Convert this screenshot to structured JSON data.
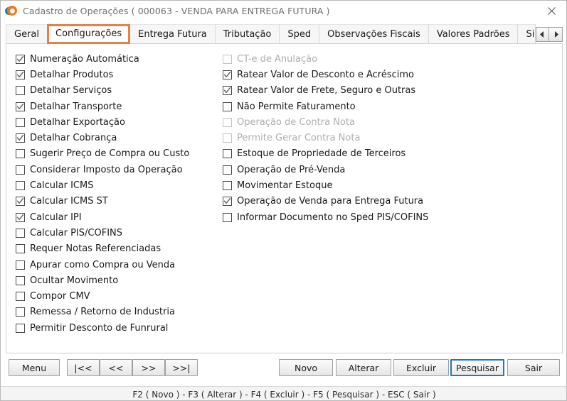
{
  "window": {
    "title": "Cadastro de Operações ( 000063 - VENDA PARA ENTREGA FUTURA )",
    "close_label": "×",
    "accent_color": "#e2814a",
    "focus_color": "#1e7bb8"
  },
  "tabs": [
    {
      "label": "Geral",
      "selected": false
    },
    {
      "label": "Configurações",
      "selected": true
    },
    {
      "label": "Entrega Futura",
      "selected": false
    },
    {
      "label": "Tributação",
      "selected": false
    },
    {
      "label": "Sped",
      "selected": false
    },
    {
      "label": "Observações Fiscais",
      "selected": false
    },
    {
      "label": "Valores Padrões",
      "selected": false
    },
    {
      "label": "Simples N",
      "selected": false,
      "clipped": true
    }
  ],
  "tab_scroll": {
    "prev_label": "◄",
    "next_label": "►"
  },
  "options_left": [
    {
      "label": "Numeração Automática",
      "checked": true,
      "disabled": false
    },
    {
      "label": "Detalhar Produtos",
      "checked": true,
      "disabled": false
    },
    {
      "label": "Detalhar Serviços",
      "checked": false,
      "disabled": false
    },
    {
      "label": "Detalhar Transporte",
      "checked": true,
      "disabled": false
    },
    {
      "label": "Detalhar Exportação",
      "checked": false,
      "disabled": false
    },
    {
      "label": "Detalhar Cobrança",
      "checked": true,
      "disabled": false
    },
    {
      "label": "Sugerir Preço de Compra ou Custo",
      "checked": false,
      "disabled": false
    },
    {
      "label": "Considerar Imposto da Operação",
      "checked": false,
      "disabled": false
    },
    {
      "label": "Calcular ICMS",
      "checked": false,
      "disabled": false
    },
    {
      "label": "Calcular ICMS ST",
      "checked": true,
      "disabled": false
    },
    {
      "label": "Calcular IPI",
      "checked": true,
      "disabled": false
    },
    {
      "label": "Calcular PIS/COFINS",
      "checked": false,
      "disabled": false
    },
    {
      "label": "Requer Notas Referenciadas",
      "checked": false,
      "disabled": false
    },
    {
      "label": "Apurar como Compra ou Venda",
      "checked": false,
      "disabled": false
    },
    {
      "label": "Ocultar Movimento",
      "checked": false,
      "disabled": false
    },
    {
      "label": "Compor CMV",
      "checked": false,
      "disabled": false
    },
    {
      "label": "Remessa / Retorno de Industria",
      "checked": false,
      "disabled": false
    },
    {
      "label": "Permitir Desconto de Funrural",
      "checked": false,
      "disabled": false
    }
  ],
  "options_right": [
    {
      "label": "CT-e de Anulação",
      "checked": false,
      "disabled": true
    },
    {
      "label": "Ratear Valor de Desconto e Acréscimo",
      "checked": true,
      "disabled": false
    },
    {
      "label": "Ratear Valor de Frete, Seguro e Outras",
      "checked": true,
      "disabled": false
    },
    {
      "label": "Não Permite Faturamento",
      "checked": false,
      "disabled": false
    },
    {
      "label": "Operação de Contra Nota",
      "checked": false,
      "disabled": true
    },
    {
      "label": "Permite Gerar Contra Nota",
      "checked": false,
      "disabled": true
    },
    {
      "label": "Estoque de Propriedade de Terceiros",
      "checked": false,
      "disabled": false
    },
    {
      "label": "Operação de Pré-Venda",
      "checked": false,
      "disabled": false
    },
    {
      "label": "Movimentar Estoque",
      "checked": false,
      "disabled": false
    },
    {
      "label": "Operação de Venda para Entrega Futura",
      "checked": true,
      "disabled": false
    },
    {
      "label": "Informar Documento no Sped PIS/COFINS",
      "checked": false,
      "disabled": false
    }
  ],
  "buttons": {
    "menu": "Menu",
    "first": "|<<",
    "prev": "<<",
    "next": ">>",
    "last": ">>|",
    "new": "Novo",
    "edit": "Alterar",
    "delete": "Excluir",
    "search": "Pesquisar",
    "exit": "Sair"
  },
  "statusbar": {
    "text": "F2 ( Novo )  -  F3 ( Alterar )  -  F4 ( Excluir )  -  F5 ( Pesquisar )  -  ESC ( Sair )"
  }
}
